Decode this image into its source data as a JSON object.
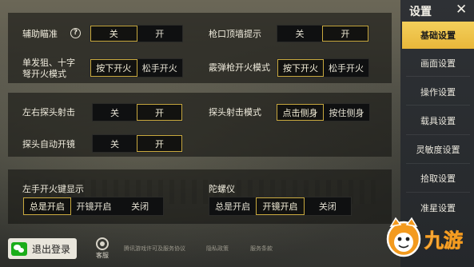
{
  "sidebar": {
    "title": "设置",
    "items": [
      {
        "label": "基础设置",
        "active": true
      },
      {
        "label": "画面设置",
        "active": false
      },
      {
        "label": "操作设置",
        "active": false
      },
      {
        "label": "载具设置",
        "active": false
      },
      {
        "label": "灵敏度设置",
        "active": false
      },
      {
        "label": "拾取设置",
        "active": false
      },
      {
        "label": "准星设置",
        "active": false
      }
    ]
  },
  "settings": {
    "aim_assist": {
      "label": "辅助瞄准",
      "options": [
        "关",
        "开"
      ],
      "selected": "关"
    },
    "muzzle_hint": {
      "label": "枪口顶墙提示",
      "options": [
        "关",
        "开"
      ],
      "selected": "开"
    },
    "single_fire": {
      "label_line1": "单发狙、十字",
      "label_line2": "弩开火模式",
      "options": [
        "按下开火",
        "松手开火"
      ],
      "selected": "按下开火"
    },
    "shotgun_fire": {
      "label": "霰弹枪开火模式",
      "options": [
        "按下开火",
        "松手开火"
      ],
      "selected": "按下开火"
    },
    "peek_fire": {
      "label": "左右探头射击",
      "options": [
        "关",
        "开"
      ],
      "selected": "开"
    },
    "peek_mode": {
      "label": "探头射击模式",
      "options": [
        "点击侧身",
        "按住侧身"
      ],
      "selected": "点击侧身"
    },
    "peek_scope": {
      "label": "探头自动开镜",
      "options": [
        "关",
        "开"
      ],
      "selected": "开"
    },
    "left_fire_key": {
      "label": "左手开火键显示",
      "options": [
        "总是开启",
        "开镜开启",
        "关闭"
      ],
      "selected": "总是开启"
    },
    "gyroscope": {
      "label": "陀螺仪",
      "options": [
        "总是开启",
        "开镜开启",
        "关闭"
      ],
      "selected": "开镜开启"
    }
  },
  "footer": {
    "logout": "退出登录",
    "service": "客服",
    "links": [
      "腾讯游戏许可及服务协议",
      "隐私政策",
      "服务条款"
    ]
  },
  "logo": {
    "text": "九游"
  },
  "colors": {
    "accent": "#c9a93e",
    "sidebar_active": "#f0c44a",
    "wechat": "#1aad19"
  }
}
